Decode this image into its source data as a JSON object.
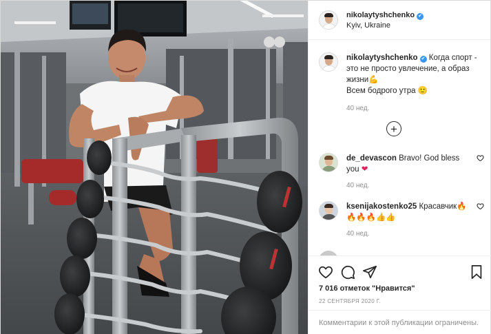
{
  "post": {
    "username": "nikolaytyshchenko",
    "verified_mark": "✔",
    "location": "Kyiv, Ukraine",
    "photo_icon": "gym-photo"
  },
  "caption": {
    "username": "nikolaytyshchenko",
    "text_1": "Когда спорт - это не просто увлечение, а образ жизни",
    "emoji_1": "💪",
    "text_2": "Всем бодрого утра",
    "emoji_2": "🙂",
    "time": "40 нед."
  },
  "load_more_symbol": "+",
  "comments": [
    {
      "username": "de_devascon",
      "text": "Bravo! God bless you",
      "emoji": "❤",
      "time": "40 нед."
    },
    {
      "username": "ksenijakostenko25",
      "text": "Красавчик",
      "emoji_flame_1": "🔥",
      "emoji_line": "🔥🔥🔥",
      "emoji_thumbs": "👍👍",
      "time": "40 нед."
    }
  ],
  "footer": {
    "likes": "7 016 отметок \"Нравится\"",
    "date": "22 СЕНТЯБРЯ 2020 Г.",
    "restricted": "Комментарии к этой публикации ограничены."
  },
  "colors": {
    "accent": "#3897f0",
    "text": "#262626",
    "muted": "#8e8e8e",
    "border": "#efefef"
  }
}
